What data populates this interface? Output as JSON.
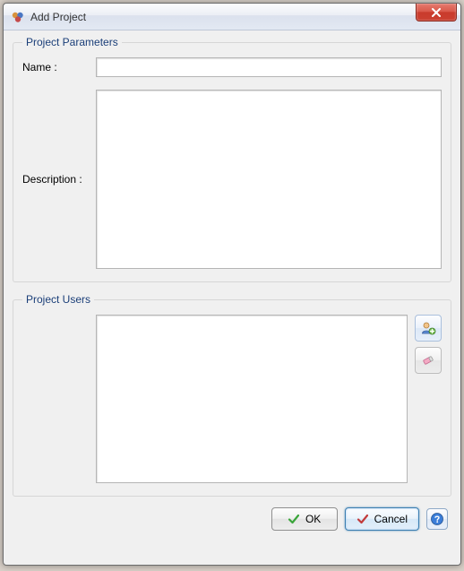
{
  "window": {
    "title": "Add Project"
  },
  "groups": {
    "parameters": {
      "legend": "Project Parameters",
      "name_label": "Name  :",
      "name_value": "",
      "desc_label": "Description  :",
      "desc_value": ""
    },
    "users": {
      "legend": "Project Users"
    }
  },
  "buttons": {
    "ok": "OK",
    "cancel": "Cancel"
  },
  "icons": {
    "app": "app-icon",
    "close": "close-icon",
    "add_user": "add-user-icon",
    "remove_user": "eraser-icon",
    "ok_check": "check-green-icon",
    "cancel_check": "check-red-icon",
    "help": "help-icon"
  }
}
